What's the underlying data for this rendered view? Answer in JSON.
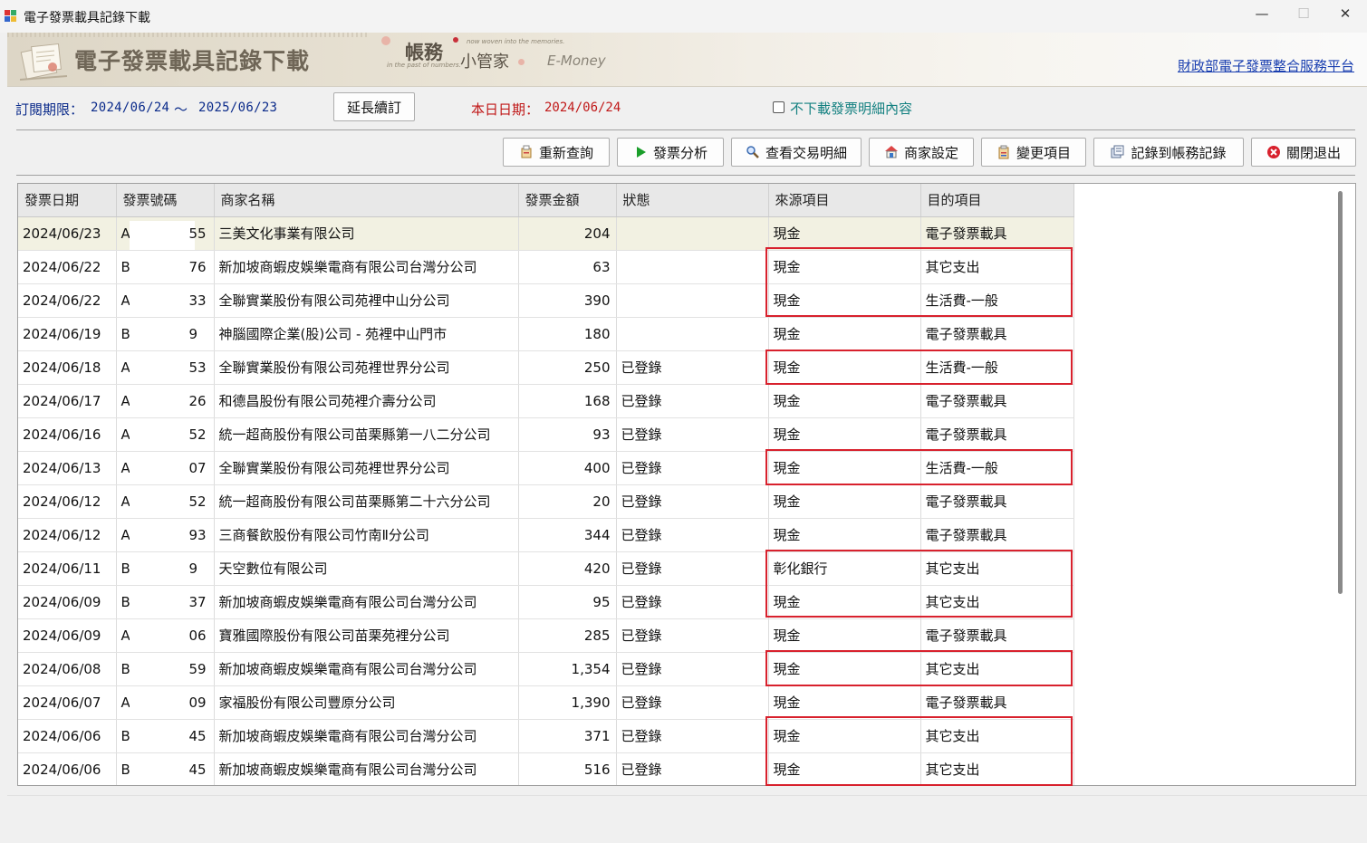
{
  "window": {
    "title": "電子發票載具記錄下載",
    "minimize": "—",
    "maximize": "☐",
    "close": "✕"
  },
  "banner": {
    "title": "電子發票載具記錄下載",
    "brand_main": "帳務",
    "brand_sub": "小管家",
    "brand_tiny1": "now woven into the memories.",
    "brand_tiny2": "in the past of numbers.",
    "brand_en": "E-Money",
    "portal_link": "財政部電子發票整合服務平台"
  },
  "subscription": {
    "label": "訂閱期限：",
    "start": "2024/06/24",
    "tilde": "～",
    "end": "2025/06/23",
    "extend_button": "延長續訂",
    "today_label": "本日日期：",
    "today": "2024/06/24",
    "no_detail_label": "不下載發票明細內容"
  },
  "toolbar": {
    "requery": "重新查詢",
    "analyze": "發票分析",
    "details": "查看交易明細",
    "merchant": "商家設定",
    "change": "變更項目",
    "record": "記錄到帳務記錄",
    "exit": "關閉退出"
  },
  "table": {
    "headers": [
      "發票日期",
      "發票號碼",
      "商家名稱",
      "發票金額",
      "狀態",
      "來源項目",
      "目的項目"
    ],
    "rows": [
      {
        "date": "2024/06/23",
        "inv_prefix": "A",
        "inv_suffix": "55",
        "merchant": "三美文化事業有限公司",
        "amount": "204",
        "status": "",
        "source": "現金",
        "target": "電子發票載具"
      },
      {
        "date": "2024/06/22",
        "inv_prefix": "B",
        "inv_suffix": "76",
        "merchant": "新加坡商蝦皮娛樂電商有限公司台灣分公司",
        "amount": "63",
        "status": "",
        "source": "現金",
        "target": "其它支出"
      },
      {
        "date": "2024/06/22",
        "inv_prefix": "A",
        "inv_suffix": "33",
        "merchant": "全聯實業股份有限公司苑裡中山分公司",
        "amount": "390",
        "status": "",
        "source": "現金",
        "target": "生活費-一般"
      },
      {
        "date": "2024/06/19",
        "inv_prefix": "B",
        "inv_suffix": "9",
        "merchant": "神腦國際企業(股)公司 - 苑裡中山門市",
        "amount": "180",
        "status": "",
        "source": "現金",
        "target": "電子發票載具"
      },
      {
        "date": "2024/06/18",
        "inv_prefix": "A",
        "inv_suffix": "53",
        "merchant": "全聯實業股份有限公司苑裡世界分公司",
        "amount": "250",
        "status": "已登錄",
        "source": "現金",
        "target": "生活費-一般"
      },
      {
        "date": "2024/06/17",
        "inv_prefix": "A",
        "inv_suffix": "26",
        "merchant": "和德昌股份有限公司苑裡介壽分公司",
        "amount": "168",
        "status": "已登錄",
        "source": "現金",
        "target": "電子發票載具"
      },
      {
        "date": "2024/06/16",
        "inv_prefix": "A",
        "inv_suffix": "52",
        "merchant": "統一超商股份有限公司苗栗縣第一八二分公司",
        "amount": "93",
        "status": "已登錄",
        "source": "現金",
        "target": "電子發票載具"
      },
      {
        "date": "2024/06/13",
        "inv_prefix": "A",
        "inv_suffix": "07",
        "merchant": "全聯實業股份有限公司苑裡世界分公司",
        "amount": "400",
        "status": "已登錄",
        "source": "現金",
        "target": "生活費-一般"
      },
      {
        "date": "2024/06/12",
        "inv_prefix": "A",
        "inv_suffix": "52",
        "merchant": "統一超商股份有限公司苗栗縣第二十六分公司",
        "amount": "20",
        "status": "已登錄",
        "source": "現金",
        "target": "電子發票載具"
      },
      {
        "date": "2024/06/12",
        "inv_prefix": "A",
        "inv_suffix": "93",
        "merchant": "三商餐飲股份有限公司竹南Ⅱ分公司",
        "amount": "344",
        "status": "已登錄",
        "source": "現金",
        "target": "電子發票載具"
      },
      {
        "date": "2024/06/11",
        "inv_prefix": "B",
        "inv_suffix": "9",
        "merchant": "天空數位有限公司",
        "amount": "420",
        "status": "已登錄",
        "source": "彰化銀行",
        "target": "其它支出"
      },
      {
        "date": "2024/06/09",
        "inv_prefix": "B",
        "inv_suffix": "37",
        "merchant": "新加坡商蝦皮娛樂電商有限公司台灣分公司",
        "amount": "95",
        "status": "已登錄",
        "source": "現金",
        "target": "其它支出"
      },
      {
        "date": "2024/06/09",
        "inv_prefix": "A",
        "inv_suffix": "06",
        "merchant": "寶雅國際股份有限公司苗栗苑裡分公司",
        "amount": "285",
        "status": "已登錄",
        "source": "現金",
        "target": "電子發票載具"
      },
      {
        "date": "2024/06/08",
        "inv_prefix": "B",
        "inv_suffix": "59",
        "merchant": "新加坡商蝦皮娛樂電商有限公司台灣分公司",
        "amount": "1,354",
        "status": "已登錄",
        "source": "現金",
        "target": "其它支出"
      },
      {
        "date": "2024/06/07",
        "inv_prefix": "A",
        "inv_suffix": "09",
        "merchant": "家福股份有限公司豐原分公司",
        "amount": "1,390",
        "status": "已登錄",
        "source": "現金",
        "target": "電子發票載具"
      },
      {
        "date": "2024/06/06",
        "inv_prefix": "B",
        "inv_suffix": "45",
        "merchant": "新加坡商蝦皮娛樂電商有限公司台灣分公司",
        "amount": "371",
        "status": "已登錄",
        "source": "現金",
        "target": "其它支出"
      },
      {
        "date": "2024/06/06",
        "inv_prefix": "B",
        "inv_suffix": "45",
        "merchant": "新加坡商蝦皮娛樂電商有限公司台灣分公司",
        "amount": "516",
        "status": "已登錄",
        "source": "現金",
        "target": "其它支出"
      }
    ]
  },
  "colors": {
    "highlight": "#d8212d",
    "link": "#1a3fb0",
    "today": "#c01818",
    "checkbox_label": "#138080"
  }
}
